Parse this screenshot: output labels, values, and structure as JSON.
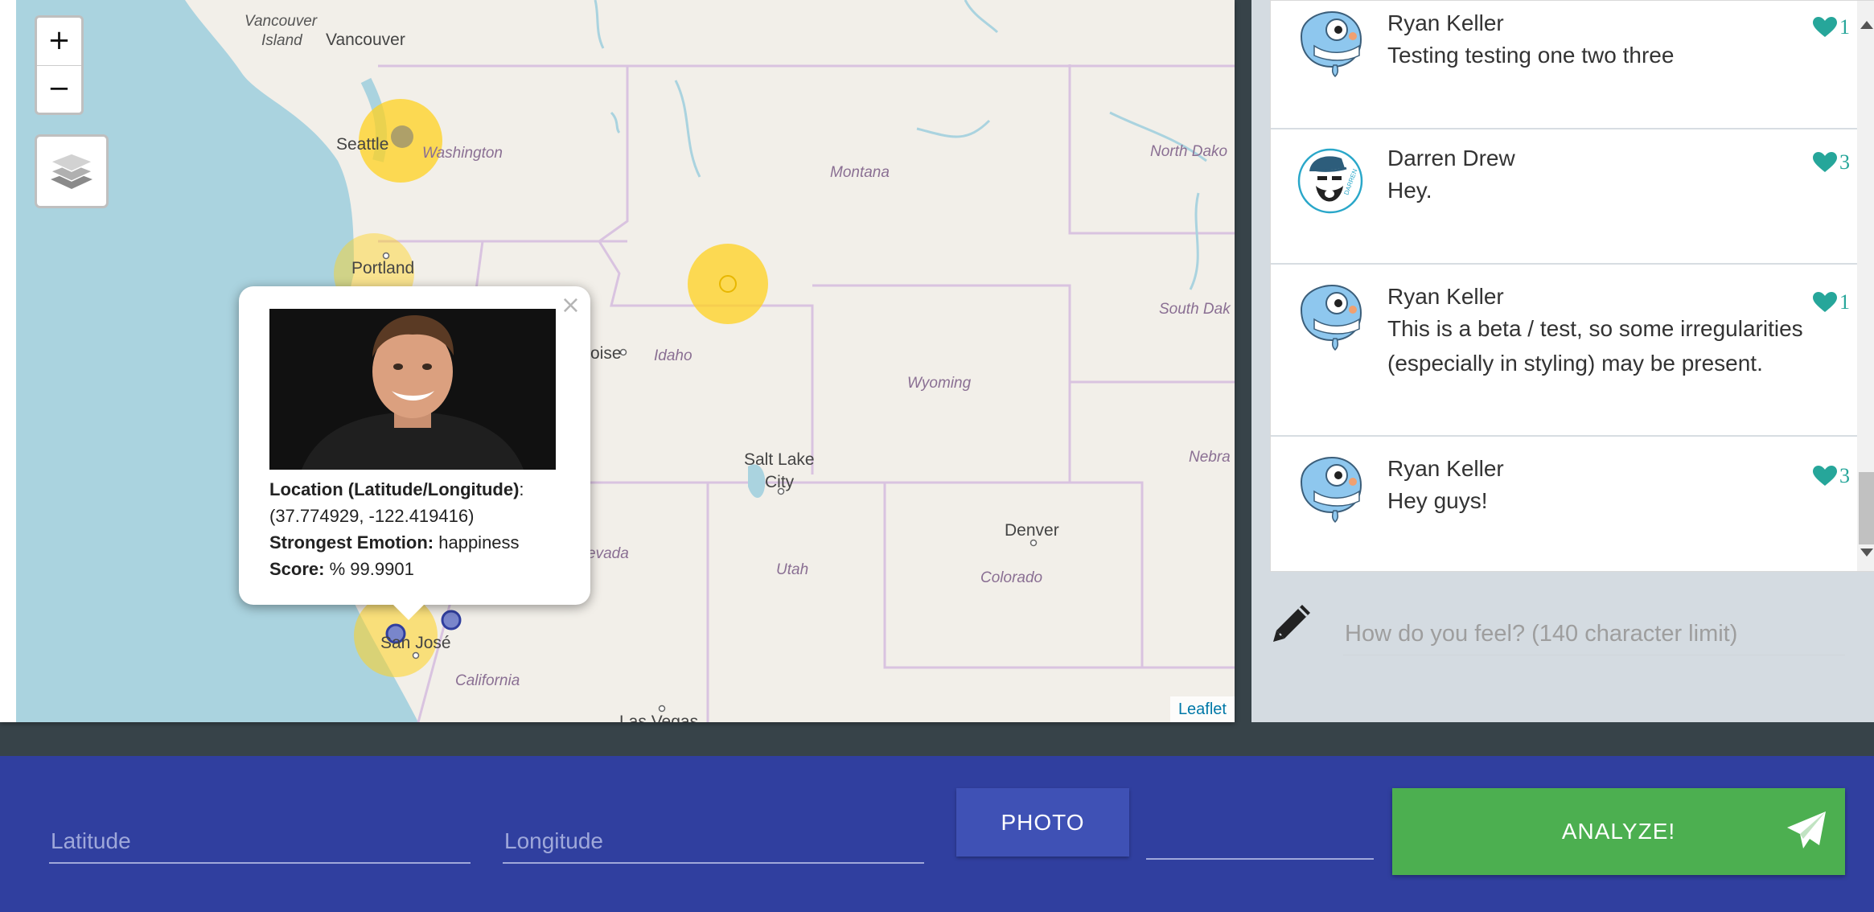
{
  "map": {
    "zoom_in": "+",
    "zoom_out": "−",
    "attribution": "Leaflet",
    "cities": [
      "Vancouver",
      "Vancouver Island",
      "Seattle",
      "Portland",
      "Boise",
      "Salt Lake City",
      "Denver",
      "San José",
      "Las Vegas"
    ],
    "states": [
      "Washington",
      "Montana",
      "North Dakota",
      "South Dakota",
      "Idaho",
      "Wyoming",
      "Nebraska",
      "Nevada",
      "Utah",
      "Colorado",
      "California"
    ],
    "labels": {
      "vancouver_island_1": "Vancouver",
      "vancouver_island_2": "Island",
      "vancouver": "Vancouver",
      "seattle": "Seattle",
      "washington": "Washington",
      "montana": "Montana",
      "north_dakota": "North Dako",
      "portland": "Portland",
      "south_dakota": "South Dak",
      "boise": "oise",
      "idaho": "Idaho",
      "wyoming": "Wyoming",
      "salt_lake_1": "Salt Lake",
      "salt_lake_2": "City",
      "nebraska": "Nebra",
      "nevada": "evada",
      "utah": "Utah",
      "denver": "Denver",
      "colorado": "Colorado",
      "san_jose": "San José",
      "california": "California",
      "las_vegas": "Las Vegas"
    },
    "marker_color": "#ffd21f",
    "popup": {
      "location_label": "Location (Latitude/Longitude)",
      "location_value": "(37.774929, -122.419416)",
      "emotion_label": "Strongest Emotion:",
      "emotion_value": "happiness",
      "score_label": "Score:",
      "score_value": "% 99.9901",
      "close": "×"
    }
  },
  "chat": {
    "messages": [
      {
        "author": "Ryan Keller",
        "text": "Testing testing one two three",
        "likes": "1",
        "avatar": "gopher-avatar-icon"
      },
      {
        "author": "Darren Drew",
        "text": "Hey.",
        "likes": "3",
        "avatar": "bearded-man-avatar-icon"
      },
      {
        "author": "Ryan Keller",
        "text": "This is a beta / test, so some irregularities (especially in styling) may be present.",
        "likes": "1",
        "avatar": "gopher-avatar-icon"
      },
      {
        "author": "Ryan Keller",
        "text": "Hey guys!",
        "likes": "3",
        "avatar": "gopher-avatar-icon"
      }
    ],
    "compose_placeholder": "How do you feel? (140 character limit)"
  },
  "controls": {
    "latitude_placeholder": "Latitude",
    "longitude_placeholder": "Longitude",
    "photo_label": "PHOTO",
    "analyze_label": "ANALYZE!"
  },
  "colors": {
    "bottom_bar": "#303f9f",
    "photo_button": "#3f51b5",
    "analyze_button": "#4caf50",
    "like_heart": "#26a69a",
    "chat_panel": "#d4dbe1"
  }
}
